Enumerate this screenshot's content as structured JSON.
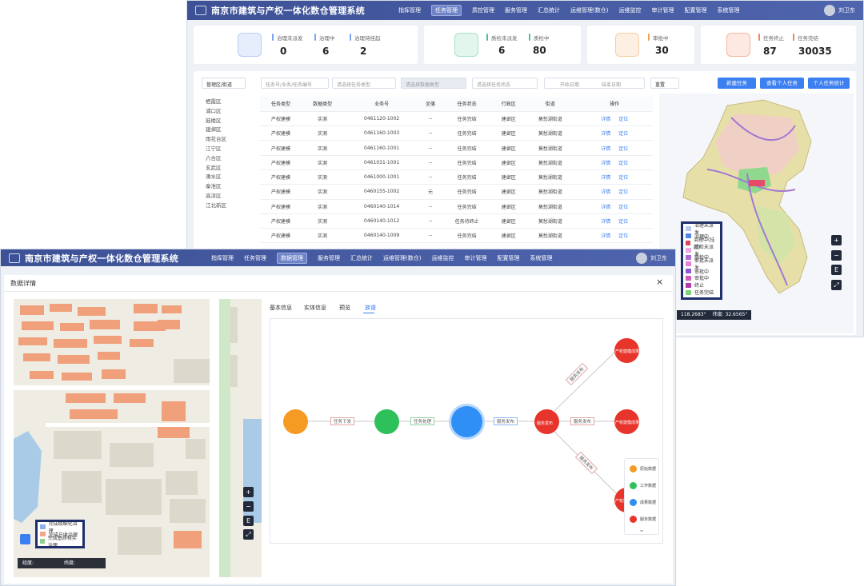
{
  "app": {
    "title": "南京市建筑与产权一体化数仓管理系统",
    "user": "刘卫东"
  },
  "nav_back": [
    "指挥管理",
    "任务管理",
    "质控管理",
    "服务管理",
    "汇总统计",
    "运维管理(数仓)",
    "运维监控",
    "审计管理",
    "配置管理",
    "系统管理"
  ],
  "nav_front": [
    "指挥管理",
    "任务管理",
    "数据管理",
    "服务管理",
    "汇总统计",
    "运维管理(数仓)",
    "运维监控",
    "审计管理",
    "配置管理",
    "系统管理"
  ],
  "stats": {
    "group1": [
      {
        "label": "治理未派发",
        "value": "0"
      },
      {
        "label": "治理中",
        "value": "6"
      },
      {
        "label": "治理待挂起",
        "value": "2"
      }
    ],
    "group2": [
      {
        "label": "质检未派发",
        "value": "6"
      },
      {
        "label": "质检中",
        "value": "80"
      }
    ],
    "group3": [
      {
        "label": "审批中",
        "value": "30"
      }
    ],
    "group4": [
      {
        "label": "任务终止",
        "value": "87"
      },
      {
        "label": "任务完结",
        "value": "30035"
      }
    ]
  },
  "filters": {
    "district": "管理区/街道",
    "search": "任务号/业务/任务编号",
    "task_type": "请选择任务类型",
    "data_type": "请选择数据类型",
    "task_state": "请选择任务状态",
    "start": "开始日期",
    "end": "结束日期",
    "reset": "重置"
  },
  "buttons": {
    "new_task": "新建任务",
    "my_tasks": "查看个人任务",
    "stats": "个人任务统计"
  },
  "districts": [
    "栖霞区",
    "浦口区",
    "鼓楼区",
    "建邺区",
    "雨花台区",
    "江宁区",
    "六合区",
    "玄武区",
    "溧水区",
    "秦淮区",
    "高淳区",
    "江北新区"
  ],
  "table": {
    "headers": [
      "任务类型",
      "数据类型",
      "业务号",
      "坐落",
      "任务状态",
      "行政区",
      "街道",
      "操作"
    ],
    "rows": [
      [
        "产权建模",
        "实测",
        "0461120-1002",
        "--",
        "任务完结",
        "建邺区",
        "莫愁湖街道"
      ],
      [
        "产权建模",
        "实测",
        "0461160-1003",
        "--",
        "任务完结",
        "建邺区",
        "莫愁湖街道"
      ],
      [
        "产权建模",
        "实测",
        "0461160-1001",
        "--",
        "任务完结",
        "建邺区",
        "莫愁湖街道"
      ],
      [
        "产权建模",
        "实测",
        "0461031-1001",
        "--",
        "任务完结",
        "建邺区",
        "莫愁湖街道"
      ],
      [
        "产权建模",
        "实测",
        "0461000-1001",
        "--",
        "任务完结",
        "建邺区",
        "莫愁湖街道"
      ],
      [
        "产权建模",
        "实测",
        "0460155-1002",
        "元",
        "任务完结",
        "建邺区",
        "莫愁湖街道"
      ],
      [
        "产权建模",
        "实测",
        "0460140-1014",
        "--",
        "任务完结",
        "建邺区",
        "莫愁湖街道"
      ],
      [
        "产权建模",
        "实测",
        "0460140-1012",
        "--",
        "任务待终止",
        "建邺区",
        "莫愁湖街道"
      ],
      [
        "产权建模",
        "实测",
        "0460140-1009",
        "--",
        "任务完结",
        "建邺区",
        "莫愁湖街道"
      ]
    ],
    "actions": [
      "详情",
      "定位"
    ]
  },
  "map_legend_back": [
    {
      "label": "治理未派发",
      "color": "#b7c9ee"
    },
    {
      "label": "治理中",
      "color": "#4f86e8"
    },
    {
      "label": "治理中(挂起)",
      "color": "#e0445a"
    },
    {
      "label": "质检未派发",
      "color": "#f0a6df"
    },
    {
      "label": "质检中",
      "color": "#b16ad6"
    },
    {
      "label": "审批未派发",
      "color": "#e681d5"
    },
    {
      "label": "审批中",
      "color": "#8b5bd0"
    },
    {
      "label": "审批中",
      "color": "#d05bbd"
    },
    {
      "label": "终止",
      "color": "#b53ab0"
    },
    {
      "label": "任务完结",
      "color": "#7cd27a"
    }
  ],
  "coords_back": {
    "lng": "118.2683°",
    "lat": "32.6565°",
    "lng_label": "经度:",
    "lat_label": "纬度:"
  },
  "map_controls": [
    "+",
    "−",
    "E",
    "⤢"
  ],
  "detail": {
    "title": "数据详情",
    "close": "×",
    "tabs": [
      "基本信息",
      "实体信息",
      "预览",
      "族谱"
    ],
    "active_tab": "族谱",
    "edges": [
      "任务下发",
      "任务处理",
      "服务发布",
      "服务发布",
      "服务发布",
      "服务发布"
    ],
    "center_label": "服务发布",
    "node_labels": [
      "产权建模成果",
      "产权建模成果",
      "产权建模成果",
      "服务发布成果"
    ],
    "node_legend": [
      {
        "label": "原始数据",
        "color": "#f59a23"
      },
      {
        "label": "工作数据",
        "color": "#2ec05a"
      },
      {
        "label": "成果数据",
        "color": "#2f8ff5"
      },
      {
        "label": "服务数据",
        "color": "#e8352b"
      }
    ],
    "map_legend": [
      {
        "label": "完成精细化治理",
        "color": "#8fb0e8"
      },
      {
        "label": "完成户收治理",
        "color": "#f2a68a"
      },
      {
        "label": "完成基质核实治理",
        "color": "#8dd18b"
      }
    ],
    "coord_lng_label": "经度:",
    "coord_lat_label": "纬度:"
  }
}
